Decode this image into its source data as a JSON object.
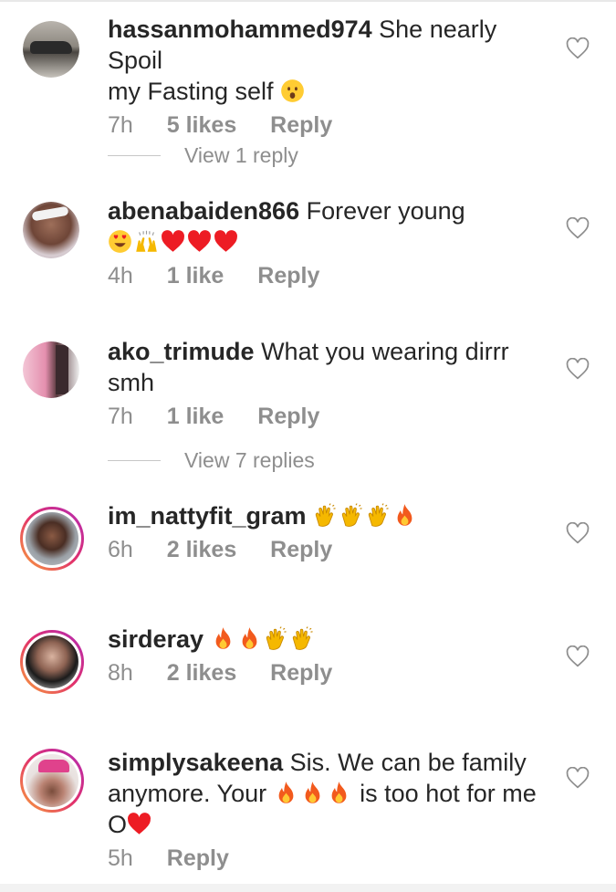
{
  "comments": [
    {
      "user": "hassanmohammed974",
      "text1": "She nearly Spoil",
      "text2": "my Fasting self",
      "time": "7h",
      "likes": "5 likes",
      "reply": "Reply"
    },
    {
      "user": "abenabaiden866",
      "text1": "Forever young",
      "time": "4h",
      "likes": "1 like",
      "reply": "Reply"
    },
    {
      "user": "ako_trimude",
      "text1": "What you wearing dirrr smh",
      "time": "7h",
      "likes": "1 like",
      "reply": "Reply"
    },
    {
      "user": "im_nattyfit_gram",
      "time": "6h",
      "likes": "2 likes",
      "reply": "Reply"
    },
    {
      "user": "sirderay",
      "time": "8h",
      "likes": "2 likes",
      "reply": "Reply"
    },
    {
      "user": "simplysakeena",
      "text1": "Sis. We can be family",
      "text2a": "anymore. Your",
      "text2b": "is too hot for me",
      "text3": "O",
      "time": "5h",
      "reply": "Reply"
    }
  ],
  "view_replies": [
    "View 1 reply",
    "View 7 replies"
  ],
  "icons": {
    "like": "heart-outline-icon",
    "emoji_face": "astonished-face",
    "emoji_heart_eyes": "heart-eyes-face",
    "emoji_hands": "raising-hands",
    "emoji_heart": "red-heart",
    "emoji_clap": "clapping-hands",
    "emoji_fire": "fire"
  },
  "colors": {
    "text": "#262626",
    "meta": "#8e8e8e",
    "story_ring_start": "#f9a33a",
    "story_ring_end": "#b22bb6",
    "heart": "#ed1c24",
    "fire": "#f25a1d",
    "clap": "#f5b800"
  }
}
